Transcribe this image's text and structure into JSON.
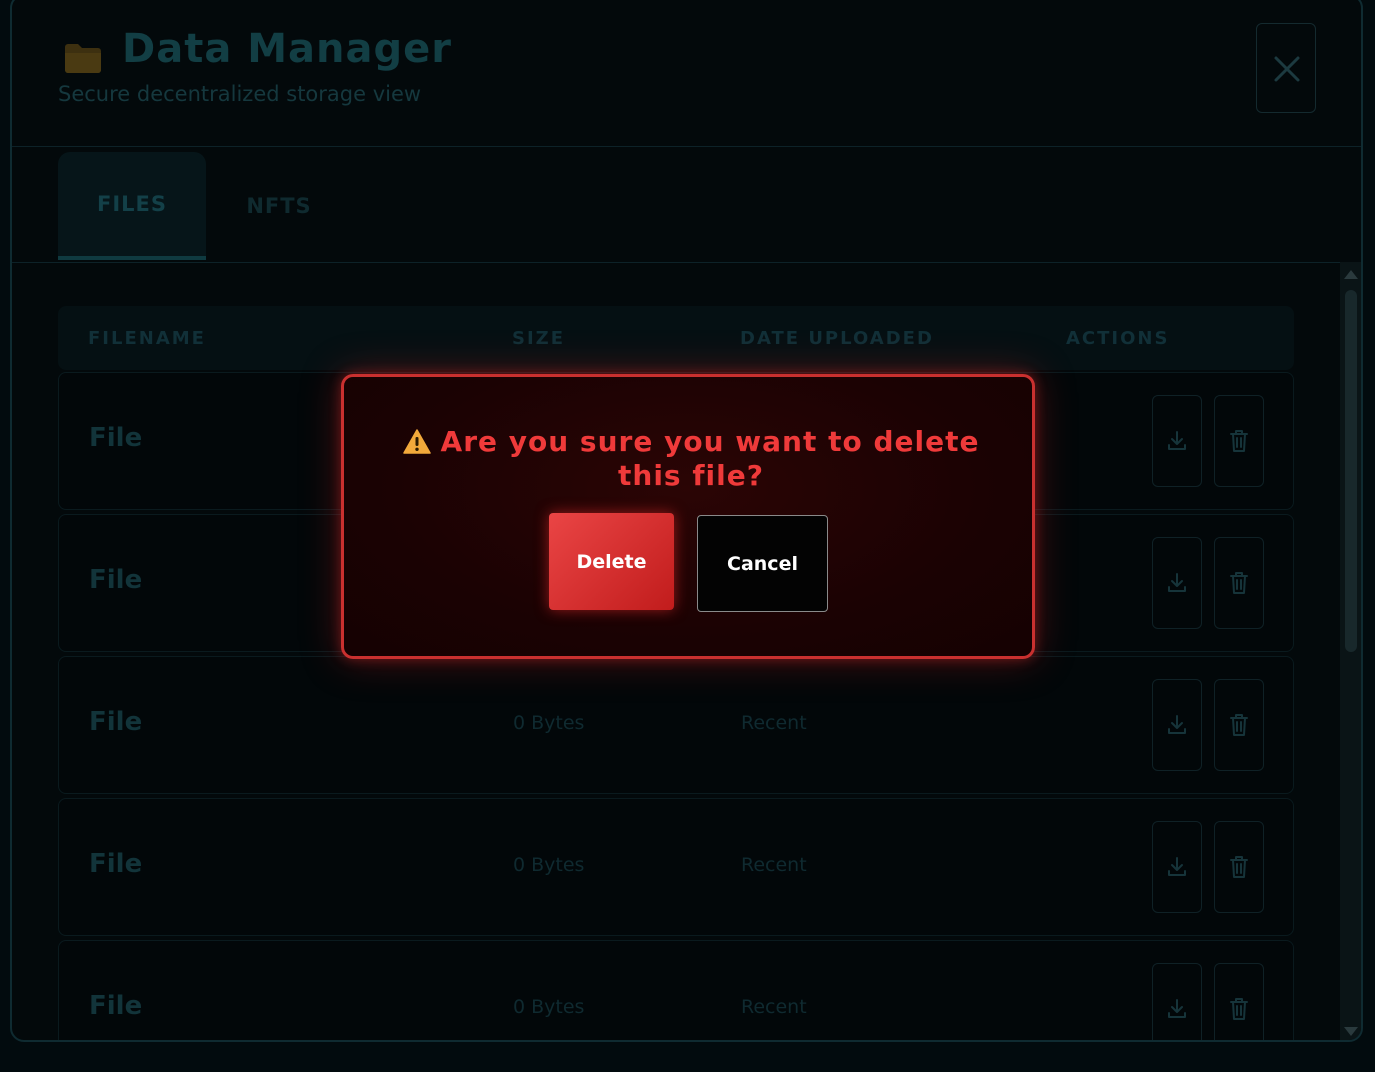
{
  "header": {
    "title": "Data Manager",
    "subtitle": "Secure decentralized storage view",
    "folder_icon": "folder-icon",
    "close_icon": "close-icon"
  },
  "tabs": [
    {
      "label": "FILES",
      "active": true
    },
    {
      "label": "NFTS",
      "active": false
    }
  ],
  "table": {
    "columns": [
      "FILENAME",
      "SIZE",
      "DATE UPLOADED",
      "ACTIONS"
    ],
    "rows": [
      {
        "name": "File",
        "size": "",
        "date": ""
      },
      {
        "name": "File",
        "size": "",
        "date": ""
      },
      {
        "name": "File",
        "size": "0 Bytes",
        "date": "Recent"
      },
      {
        "name": "File",
        "size": "0 Bytes",
        "date": "Recent"
      },
      {
        "name": "File",
        "size": "0 Bytes",
        "date": "Recent"
      }
    ],
    "row_actions": [
      "download-icon",
      "trash-icon"
    ]
  },
  "modal": {
    "message": "Are you sure you want to delete this file?",
    "warning_icon": "warning-icon",
    "delete_label": "Delete",
    "cancel_label": "Cancel",
    "accent_color": "#ef3a3a"
  }
}
